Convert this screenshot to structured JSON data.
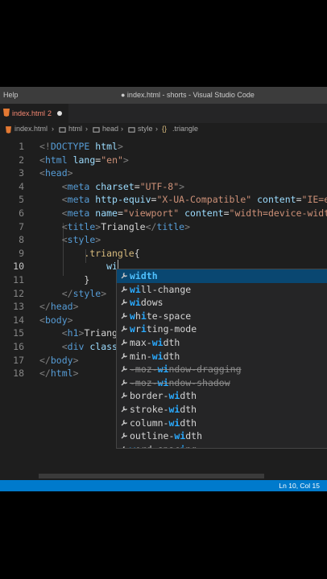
{
  "titlebar": {
    "menu": "Help",
    "title": "● index.html - shorts - Visual Studio Code"
  },
  "tab": {
    "label": "index.html",
    "problems": "2"
  },
  "breadcrumb": [
    "index.html",
    "html",
    "head",
    "style",
    ".triangle"
  ],
  "lines": [
    {
      "n": 1,
      "tokens": [
        [
          "t-punc",
          "<!"
        ],
        [
          "t-tag",
          "DOCTYPE"
        ],
        [
          "t-txt",
          " "
        ],
        [
          "t-attr",
          "html"
        ],
        [
          "t-punc",
          ">"
        ]
      ]
    },
    {
      "n": 2,
      "tokens": [
        [
          "t-punc",
          "<"
        ],
        [
          "t-tag",
          "html"
        ],
        [
          "t-txt",
          " "
        ],
        [
          "t-attr",
          "lang"
        ],
        [
          "t-txt",
          "="
        ],
        [
          "t-str",
          "\"en\""
        ],
        [
          "t-punc",
          ">"
        ]
      ]
    },
    {
      "n": 3,
      "tokens": [
        [
          "t-punc",
          "<"
        ],
        [
          "t-tag",
          "head"
        ],
        [
          "t-punc",
          ">"
        ]
      ]
    },
    {
      "n": 4,
      "tokens": [
        [
          "t-txt",
          "    "
        ],
        [
          "t-punc",
          "<"
        ],
        [
          "t-tag",
          "meta"
        ],
        [
          "t-txt",
          " "
        ],
        [
          "t-attr",
          "charset"
        ],
        [
          "t-txt",
          "="
        ],
        [
          "t-str",
          "\"UTF-8\""
        ],
        [
          "t-punc",
          ">"
        ]
      ]
    },
    {
      "n": 5,
      "tokens": [
        [
          "t-txt",
          "    "
        ],
        [
          "t-punc",
          "<"
        ],
        [
          "t-tag",
          "meta"
        ],
        [
          "t-txt",
          " "
        ],
        [
          "t-attr",
          "http-equiv"
        ],
        [
          "t-txt",
          "="
        ],
        [
          "t-str",
          "\"X-UA-Compatible\""
        ],
        [
          "t-txt",
          " "
        ],
        [
          "t-attr",
          "content"
        ],
        [
          "t-txt",
          "="
        ],
        [
          "t-str",
          "\"IE=e"
        ]
      ]
    },
    {
      "n": 6,
      "tokens": [
        [
          "t-txt",
          "    "
        ],
        [
          "t-punc",
          "<"
        ],
        [
          "t-tag",
          "meta"
        ],
        [
          "t-txt",
          " "
        ],
        [
          "t-attr",
          "name"
        ],
        [
          "t-txt",
          "="
        ],
        [
          "t-str",
          "\"viewport\""
        ],
        [
          "t-txt",
          " "
        ],
        [
          "t-attr",
          "content"
        ],
        [
          "t-txt",
          "="
        ],
        [
          "t-str",
          "\"width=device-widt"
        ]
      ]
    },
    {
      "n": 7,
      "tokens": [
        [
          "t-txt",
          "    "
        ],
        [
          "t-punc",
          "<"
        ],
        [
          "t-tag",
          "title"
        ],
        [
          "t-punc",
          ">"
        ],
        [
          "t-txt",
          "Triangle"
        ],
        [
          "t-punc",
          "</"
        ],
        [
          "t-tag",
          "title"
        ],
        [
          "t-punc",
          ">"
        ]
      ]
    },
    {
      "n": 8,
      "tokens": [
        [
          "t-txt",
          "    "
        ],
        [
          "t-punc",
          "<"
        ],
        [
          "t-tag",
          "style"
        ],
        [
          "t-punc",
          ">"
        ]
      ]
    },
    {
      "n": 9,
      "tokens": [
        [
          "t-txt",
          "        "
        ],
        [
          "t-sel",
          ".triangle"
        ],
        [
          "t-txt",
          "{"
        ]
      ]
    },
    {
      "n": 10,
      "tokens": [
        [
          "t-txt",
          "            "
        ],
        [
          "t-attr",
          "wi"
        ]
      ]
    },
    {
      "n": 11,
      "tokens": [
        [
          "t-txt",
          "        "
        ],
        [
          "t-txt",
          "}"
        ]
      ]
    },
    {
      "n": 12,
      "tokens": [
        [
          "t-txt",
          "    "
        ],
        [
          "t-punc",
          "</"
        ],
        [
          "t-tag",
          "style"
        ],
        [
          "t-punc",
          ">"
        ]
      ]
    },
    {
      "n": 13,
      "tokens": [
        [
          "t-punc",
          "</"
        ],
        [
          "t-tag",
          "head"
        ],
        [
          "t-punc",
          ">"
        ]
      ]
    },
    {
      "n": 14,
      "tokens": [
        [
          "t-punc",
          "<"
        ],
        [
          "t-tag",
          "body"
        ],
        [
          "t-punc",
          ">"
        ]
      ]
    },
    {
      "n": 15,
      "tokens": [
        [
          "t-txt",
          "    "
        ],
        [
          "t-punc",
          "<"
        ],
        [
          "t-tag",
          "h1"
        ],
        [
          "t-punc",
          ">"
        ],
        [
          "t-txt",
          "Triang"
        ]
      ]
    },
    {
      "n": 16,
      "tokens": [
        [
          "t-txt",
          "    "
        ],
        [
          "t-punc",
          "<"
        ],
        [
          "t-tag",
          "div"
        ],
        [
          "t-txt",
          " "
        ],
        [
          "t-attr",
          "class"
        ]
      ]
    },
    {
      "n": 17,
      "tokens": [
        [
          "t-punc",
          "</"
        ],
        [
          "t-tag",
          "body"
        ],
        [
          "t-punc",
          ">"
        ]
      ]
    },
    {
      "n": 18,
      "tokens": [
        [
          "t-punc",
          "</"
        ],
        [
          "t-tag",
          "html"
        ],
        [
          "t-punc",
          ">"
        ]
      ]
    }
  ],
  "active_line": 10,
  "suggestions": [
    {
      "pre": "",
      "match": "width",
      "post": "",
      "selected": true
    },
    {
      "pre": "",
      "match": "wi",
      "post": "ll-change"
    },
    {
      "pre": "",
      "match": "wi",
      "post": "dows"
    },
    {
      "pre": "",
      "match": "w",
      "post": "h",
      "match2": "i",
      "post2": "te-space"
    },
    {
      "pre": "",
      "match": "w",
      "post": "r",
      "match2": "i",
      "post2": "ting-mode"
    },
    {
      "pre": "max-",
      "match": "wi",
      "post": "dth"
    },
    {
      "pre": "min-",
      "match": "wi",
      "post": "dth"
    },
    {
      "pre": "-moz-",
      "match": "wi",
      "post": "ndow-dragging",
      "deprecated": true
    },
    {
      "pre": "-moz-",
      "match": "wi",
      "post": "ndow-shadow",
      "deprecated": true
    },
    {
      "pre": "border-",
      "match": "wi",
      "post": "dth"
    },
    {
      "pre": "stroke-",
      "match": "wi",
      "post": "dth"
    },
    {
      "pre": "column-",
      "match": "wi",
      "post": "dth"
    },
    {
      "pre": "outline-",
      "match": "wi",
      "post": "dth"
    },
    {
      "pre": "",
      "match": "w",
      "post": "ord-spac",
      "match2": "i",
      "post2": "ng"
    }
  ],
  "statusbar": {
    "position": "Ln 10, Col 15"
  },
  "colors": {
    "accent": "#007acc",
    "error": "#f48771",
    "selection": "#094771"
  }
}
